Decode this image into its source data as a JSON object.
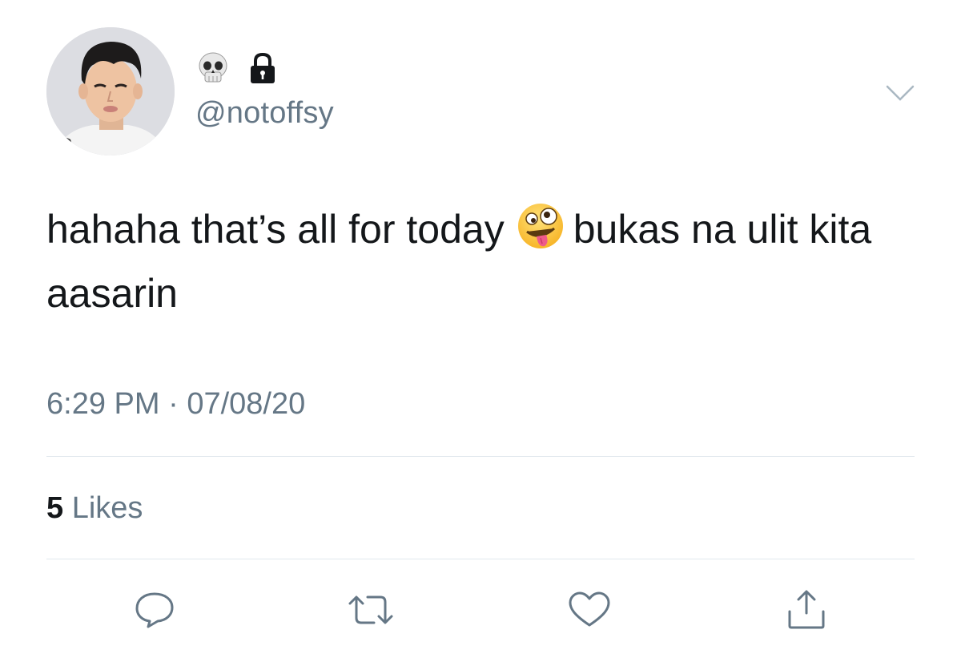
{
  "user": {
    "display_name_icons": [
      "skull-emoji-icon",
      "lock-icon"
    ],
    "handle": "@notoffsy"
  },
  "tweet": {
    "text_before_emoji": "hahaha that’s all for today",
    "emoji": "zany-face-emoji-icon",
    "text_after_emoji": "bukas na ulit kita aasarin",
    "time": "6:29 PM",
    "separator": "·",
    "date": "07/08/20"
  },
  "stats": {
    "likes_count": "5",
    "likes_label": "Likes"
  },
  "actions": [
    {
      "name": "reply",
      "icon": "speech-bubble-icon"
    },
    {
      "name": "retweet",
      "icon": "retweet-arrows-icon"
    },
    {
      "name": "like",
      "icon": "heart-icon"
    },
    {
      "name": "share",
      "icon": "share-upload-icon"
    }
  ],
  "colors": {
    "text": "#14171a",
    "secondary_text": "#657786",
    "divider": "#e1e8ed",
    "icon": "#657786"
  }
}
